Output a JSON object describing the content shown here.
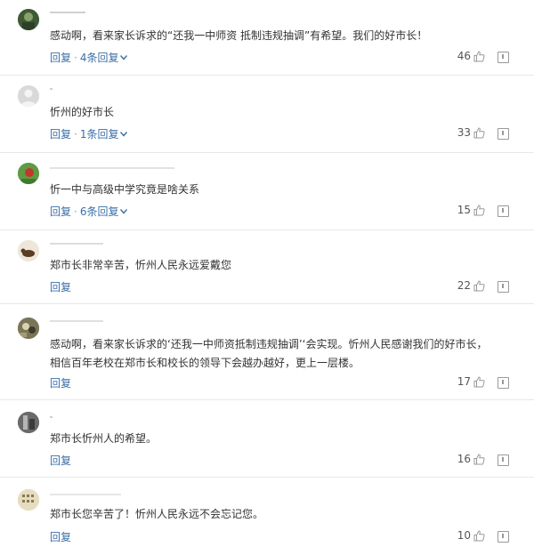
{
  "comments": [
    {
      "text": [
        "感动啊，看来家长诉求的“还我一中师资 抵制违规抽调”有希望。我们的好市长！"
      ],
      "reply_label": "回复",
      "replies_label": "4条回复",
      "likes": "46",
      "avatar_color": "#4a6a3a"
    },
    {
      "text": [
        "忻州的好市长"
      ],
      "reply_label": "回复",
      "replies_label": "1条回复",
      "likes": "33",
      "avatar_color": "#c8c8c8"
    },
    {
      "text": [
        "忻一中与高级中学究竟是啥关系"
      ],
      "reply_label": "回复",
      "replies_label": "6条回复",
      "likes": "15",
      "avatar_color": "#6aa84f"
    },
    {
      "text": [
        "郑市长非常辛苦，忻州人民永远爱戴您"
      ],
      "reply_label": "回复",
      "likes": "22",
      "avatar_color": "#8a6a4a"
    },
    {
      "text": [
        "感动啊，看来家长诉求的‘还我一中师资抵制违规抽调’‘会实现。忻州人民感谢我们的好市长，",
        "相信百年老校在郑市长和校长的领导下会越办越好，更上一层楼。"
      ],
      "reply_label": "回复",
      "likes": "17",
      "avatar_color": "#7a7a5a"
    },
    {
      "text": [
        "郑市长忻州人的希望。"
      ],
      "reply_label": "回复",
      "likes": "16",
      "avatar_color": "#5a5a5a"
    },
    {
      "text": [
        "郑市长您辛苦了！忻州人民永远不会忘记您。"
      ],
      "reply_label": "回复",
      "likes": "10",
      "avatar_color": "#d8c9a0"
    }
  ],
  "colors": {
    "link": "#3b6fa8",
    "text": "#333333",
    "divider": "#e8e8e8"
  },
  "icons": {
    "like": "thumbs-up-icon",
    "report": "report-icon",
    "expand": "chevron-down-icon"
  }
}
